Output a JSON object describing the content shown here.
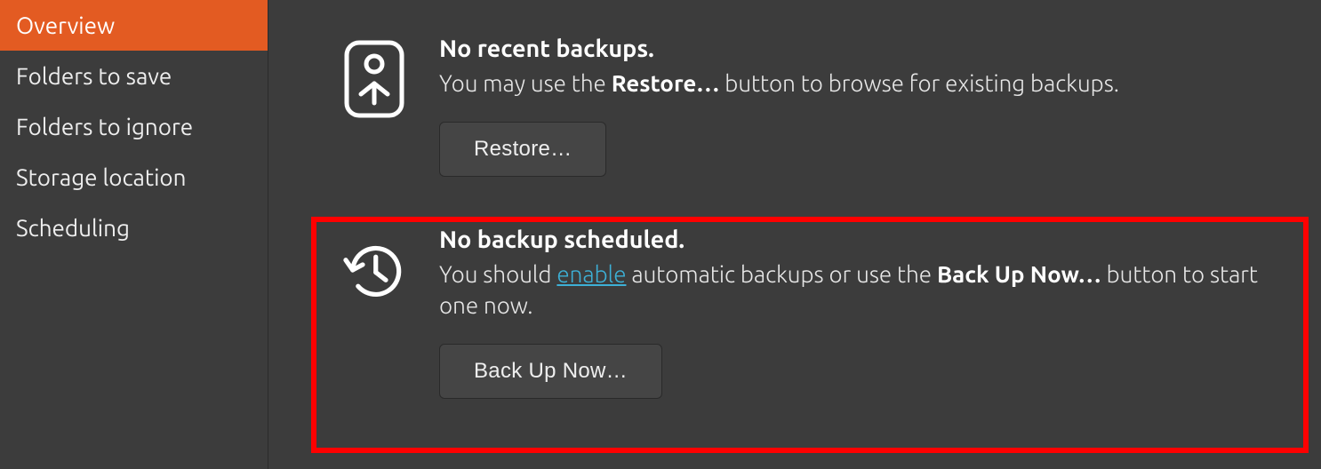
{
  "sidebar": {
    "items": [
      {
        "label": "Overview",
        "active": true
      },
      {
        "label": "Folders to save",
        "active": false
      },
      {
        "label": "Folders to ignore",
        "active": false
      },
      {
        "label": "Storage location",
        "active": false
      },
      {
        "label": "Scheduling",
        "active": false
      }
    ]
  },
  "main": {
    "restore_section": {
      "title": "No recent backups.",
      "text_before": "You may use the ",
      "bold": "Restore…",
      "text_after": " button to browse for existing backups.",
      "button": "Restore…"
    },
    "schedule_section": {
      "title": "No backup scheduled.",
      "text_a": "You should ",
      "link": "enable",
      "text_b": " automatic backups or use the ",
      "bold": "Back Up Now…",
      "text_c": " button to start one now.",
      "button": "Back Up Now…"
    }
  }
}
